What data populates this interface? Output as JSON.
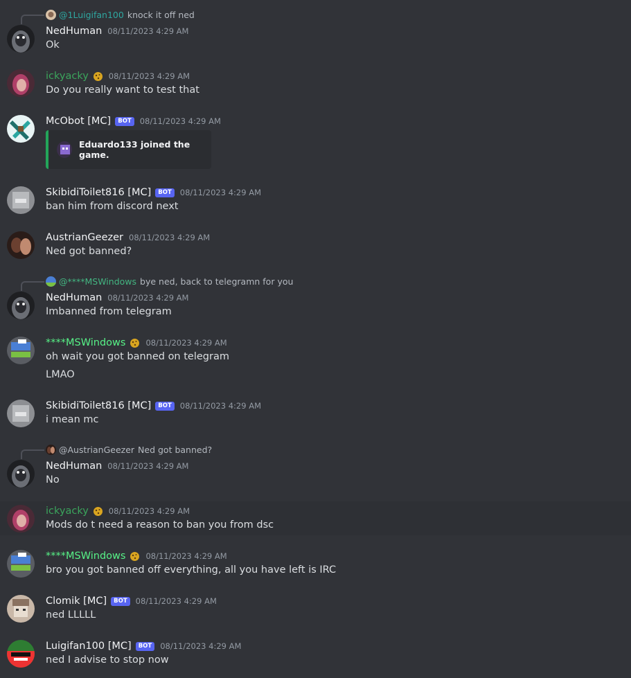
{
  "colors": {
    "background": "#313338",
    "bot_badge": "#5865f2",
    "embed_bar": "#23a55a",
    "username_green": "#3ba55c"
  },
  "messages": [
    {
      "reply": {
        "name": "@1Luigifan100",
        "text": "knock it off ned"
      },
      "user": "NedHuman",
      "time": "08/11/2023 4:29 AM",
      "lines": [
        "Ok"
      ]
    },
    {
      "user": "ickyacky",
      "time": "08/11/2023 4:29 AM",
      "lines": [
        "Do you really want to test that"
      ]
    },
    {
      "user": "McObot [MC]",
      "bot": "BOT",
      "time": "08/11/2023 4:29 AM",
      "embed": "Eduardo133 joined the game."
    },
    {
      "user": "SkibidiToilet816 [MC]",
      "bot": "BOT",
      "time": "08/11/2023 4:29 AM",
      "lines": [
        "ban him from discord next"
      ]
    },
    {
      "user": "AustrianGeezer",
      "time": "08/11/2023 4:29 AM",
      "lines": [
        "Ned got banned?"
      ]
    },
    {
      "reply": {
        "name": "@****MSWindows",
        "text": "bye ned, back to telegramn for you"
      },
      "user": "NedHuman",
      "time": "08/11/2023 4:29 AM",
      "lines": [
        "Imbanned from telegram"
      ]
    },
    {
      "user": "****MSWindows",
      "time": "08/11/2023 4:29 AM",
      "lines": [
        "oh wait you got banned on telegram",
        "LMAO"
      ]
    },
    {
      "user": "SkibidiToilet816 [MC]",
      "bot": "BOT",
      "time": "08/11/2023 4:29 AM",
      "lines": [
        "i mean mc"
      ]
    },
    {
      "reply": {
        "name": "@AustrianGeezer",
        "text": "Ned got banned?"
      },
      "user": "NedHuman",
      "time": "08/11/2023 4:29 AM",
      "lines": [
        "No"
      ]
    },
    {
      "user": "ickyacky",
      "time": "08/11/2023 4:29 AM",
      "lines": [
        "Mods do t need a reason to ban you from dsc"
      ]
    },
    {
      "user": "****MSWindows",
      "time": "08/11/2023 4:29 AM",
      "lines": [
        "bro you got banned off everything, all you have left is IRC"
      ]
    },
    {
      "user": "Clomik [MC]",
      "bot": "BOT",
      "time": "08/11/2023 4:29 AM",
      "lines": [
        "ned LLLLL"
      ]
    },
    {
      "user": "Luigifan100 [MC]",
      "bot": "BOT",
      "time": "08/11/2023 4:29 AM",
      "lines": [
        "ned I advise to stop now"
      ]
    }
  ]
}
